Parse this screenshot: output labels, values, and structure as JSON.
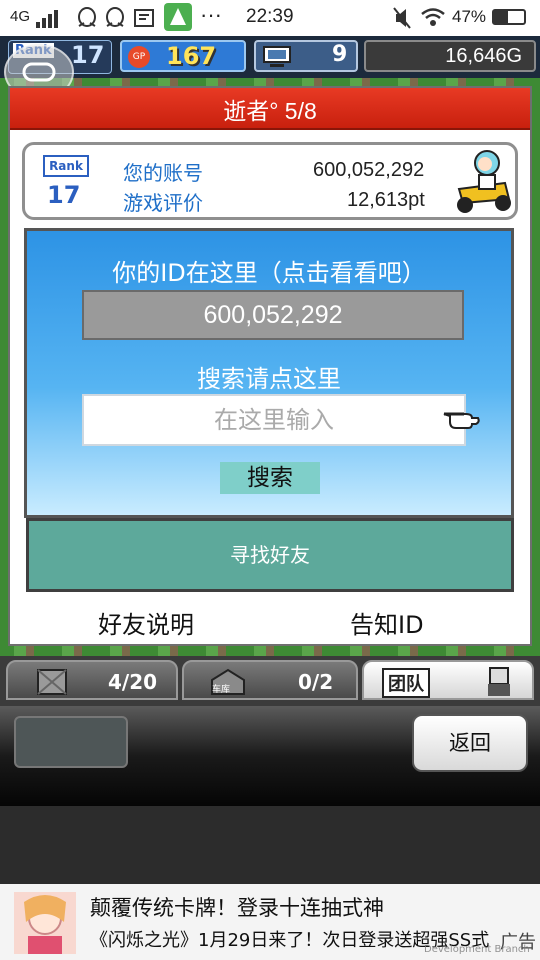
{
  "status_bar": {
    "network": "4G",
    "time": "22:39",
    "battery": "47%",
    "icons": [
      "signal-icon",
      "qq-icon",
      "qq-icon",
      "photo-icon",
      "app-icon",
      "more-icon",
      "mute-icon",
      "wifi-icon",
      "battery-icon"
    ]
  },
  "hud": {
    "rank_label": "Rank",
    "rank_value": "17",
    "gp_label": "GP",
    "gp_value": "167",
    "pc_count": "9",
    "gold": "16,646G"
  },
  "dialog": {
    "title": "逝者° 5/8",
    "player": {
      "rank_label": "Rank",
      "rank_value": "17",
      "account_label": "您的账号",
      "account_value": "600,052,292",
      "rating_label": "游戏评价",
      "rating_value": "12,613pt"
    },
    "id_heading": "你的ID在这里（点击看看吧）",
    "id_value": "600,052,292",
    "search_heading": "搜索请点这里",
    "search_placeholder": "在这里输入",
    "search_button": "搜索",
    "find_friends": "寻找好友",
    "friend_help": "好友说明",
    "notify_id": "告知ID"
  },
  "bottom_tabs": {
    "tab1_count": "4/20",
    "tab2_label": "车库",
    "tab2_count": "0/2",
    "tab3_label": "团队"
  },
  "back_button": "返回",
  "ad": {
    "line1": "颠覆传统卡牌！登录十连抽式神",
    "line2": "《闪烁之光》1月29日来了！次日登录送超强SS式",
    "badge": "广告",
    "watermark": "Development Branch"
  },
  "colors": {
    "title_red": "#e83a24",
    "blue_panel": "#3d9ae8",
    "teal_button": "#5da99b",
    "search_button": "#7fcfc9"
  }
}
